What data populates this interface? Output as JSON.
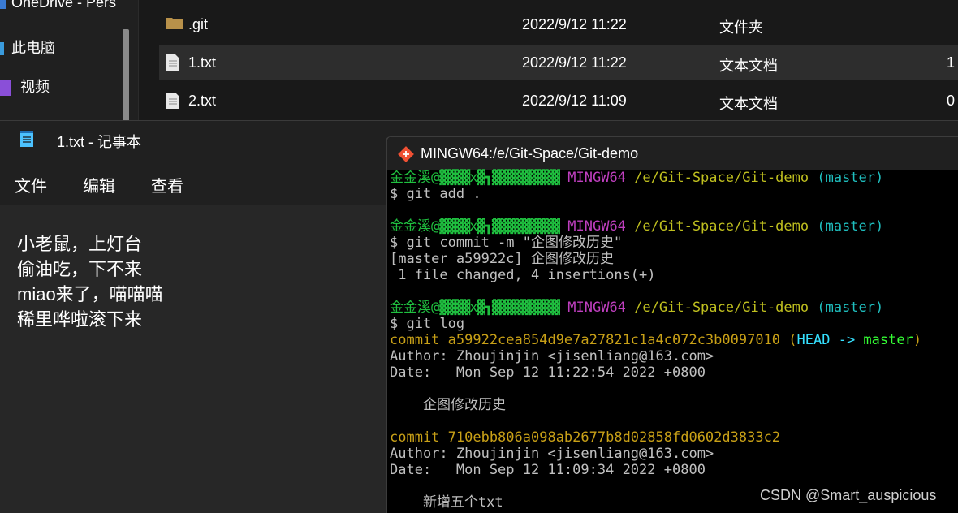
{
  "explorer": {
    "nav": [
      {
        "label": "OneDrive - Pers",
        "icon": "cloud-icon"
      },
      {
        "label": "此电脑",
        "icon": "computer-icon"
      },
      {
        "label": "视频",
        "icon": "video-icon"
      }
    ],
    "files": [
      {
        "name": ".git",
        "date": "2022/9/12 11:22",
        "type": "文件夹",
        "size": "",
        "icon": "folder-icon"
      },
      {
        "name": "1.txt",
        "date": "2022/9/12 11:22",
        "type": "文本文档",
        "size": "1",
        "icon": "text-file-icon"
      },
      {
        "name": "2.txt",
        "date": "2022/9/12 11:09",
        "type": "文本文档",
        "size": "0",
        "icon": "text-file-icon"
      }
    ]
  },
  "notepad": {
    "title": "1.txt - 记事本",
    "menu": [
      "文件",
      "编辑",
      "查看"
    ],
    "lines": [
      "小老鼠，上灯台",
      "偷油吃，下不来",
      "miao来了，喵喵喵",
      "稀里哗啦滚下来"
    ]
  },
  "terminal": {
    "title": "MINGW64:/e/Git-Space/Git-demo",
    "prompt": {
      "user": "金金溪@",
      "host_mask": "▓▓▓▓x▓┓▓▓▓▓▓▓▓▓▓",
      "env": "MINGW64",
      "path": "/e/Git-Space/Git-demo",
      "branch": "(master)"
    },
    "cmd_add": "$ git add .",
    "cmd_commit": "$ git commit -m \"企图修改历史\"",
    "commit_out1": "[master a59922c] 企图修改历史",
    "commit_out2": " 1 file changed, 4 insertions(+)",
    "cmd_log": "$ git log",
    "log": [
      {
        "commit": "commit a59922cea854d9e7a27821c1a4c072c3b0097010",
        "ref_open": " (",
        "head": "HEAD -> ",
        "ref_branch": "master",
        "ref_close": ")",
        "author": "Author: Zhoujinjin <jisenliang@163.com>",
        "date": "Date:   Mon Sep 12 11:22:54 2022 +0800",
        "message": "    企图修改历史"
      },
      {
        "commit": "commit 710ebb806a098ab2677b8d02858fd0602d3833c2",
        "ref_open": "",
        "head": "",
        "ref_branch": "",
        "ref_close": "",
        "author": "Author: Zhoujinjin <jisenliang@163.com>",
        "date": "Date:   Mon Sep 12 11:09:34 2022 +0800",
        "message": "    新增五个txt"
      }
    ]
  },
  "watermark": "CSDN @Smart_auspicious",
  "colors": {
    "bg": "#191919",
    "terminal_bg": "#000000",
    "green": "#1fbf3f",
    "magenta": "#bf3fbf",
    "yellow": "#bfbf1f",
    "cyan": "#1fbfbf",
    "orange": "#c8a017"
  }
}
